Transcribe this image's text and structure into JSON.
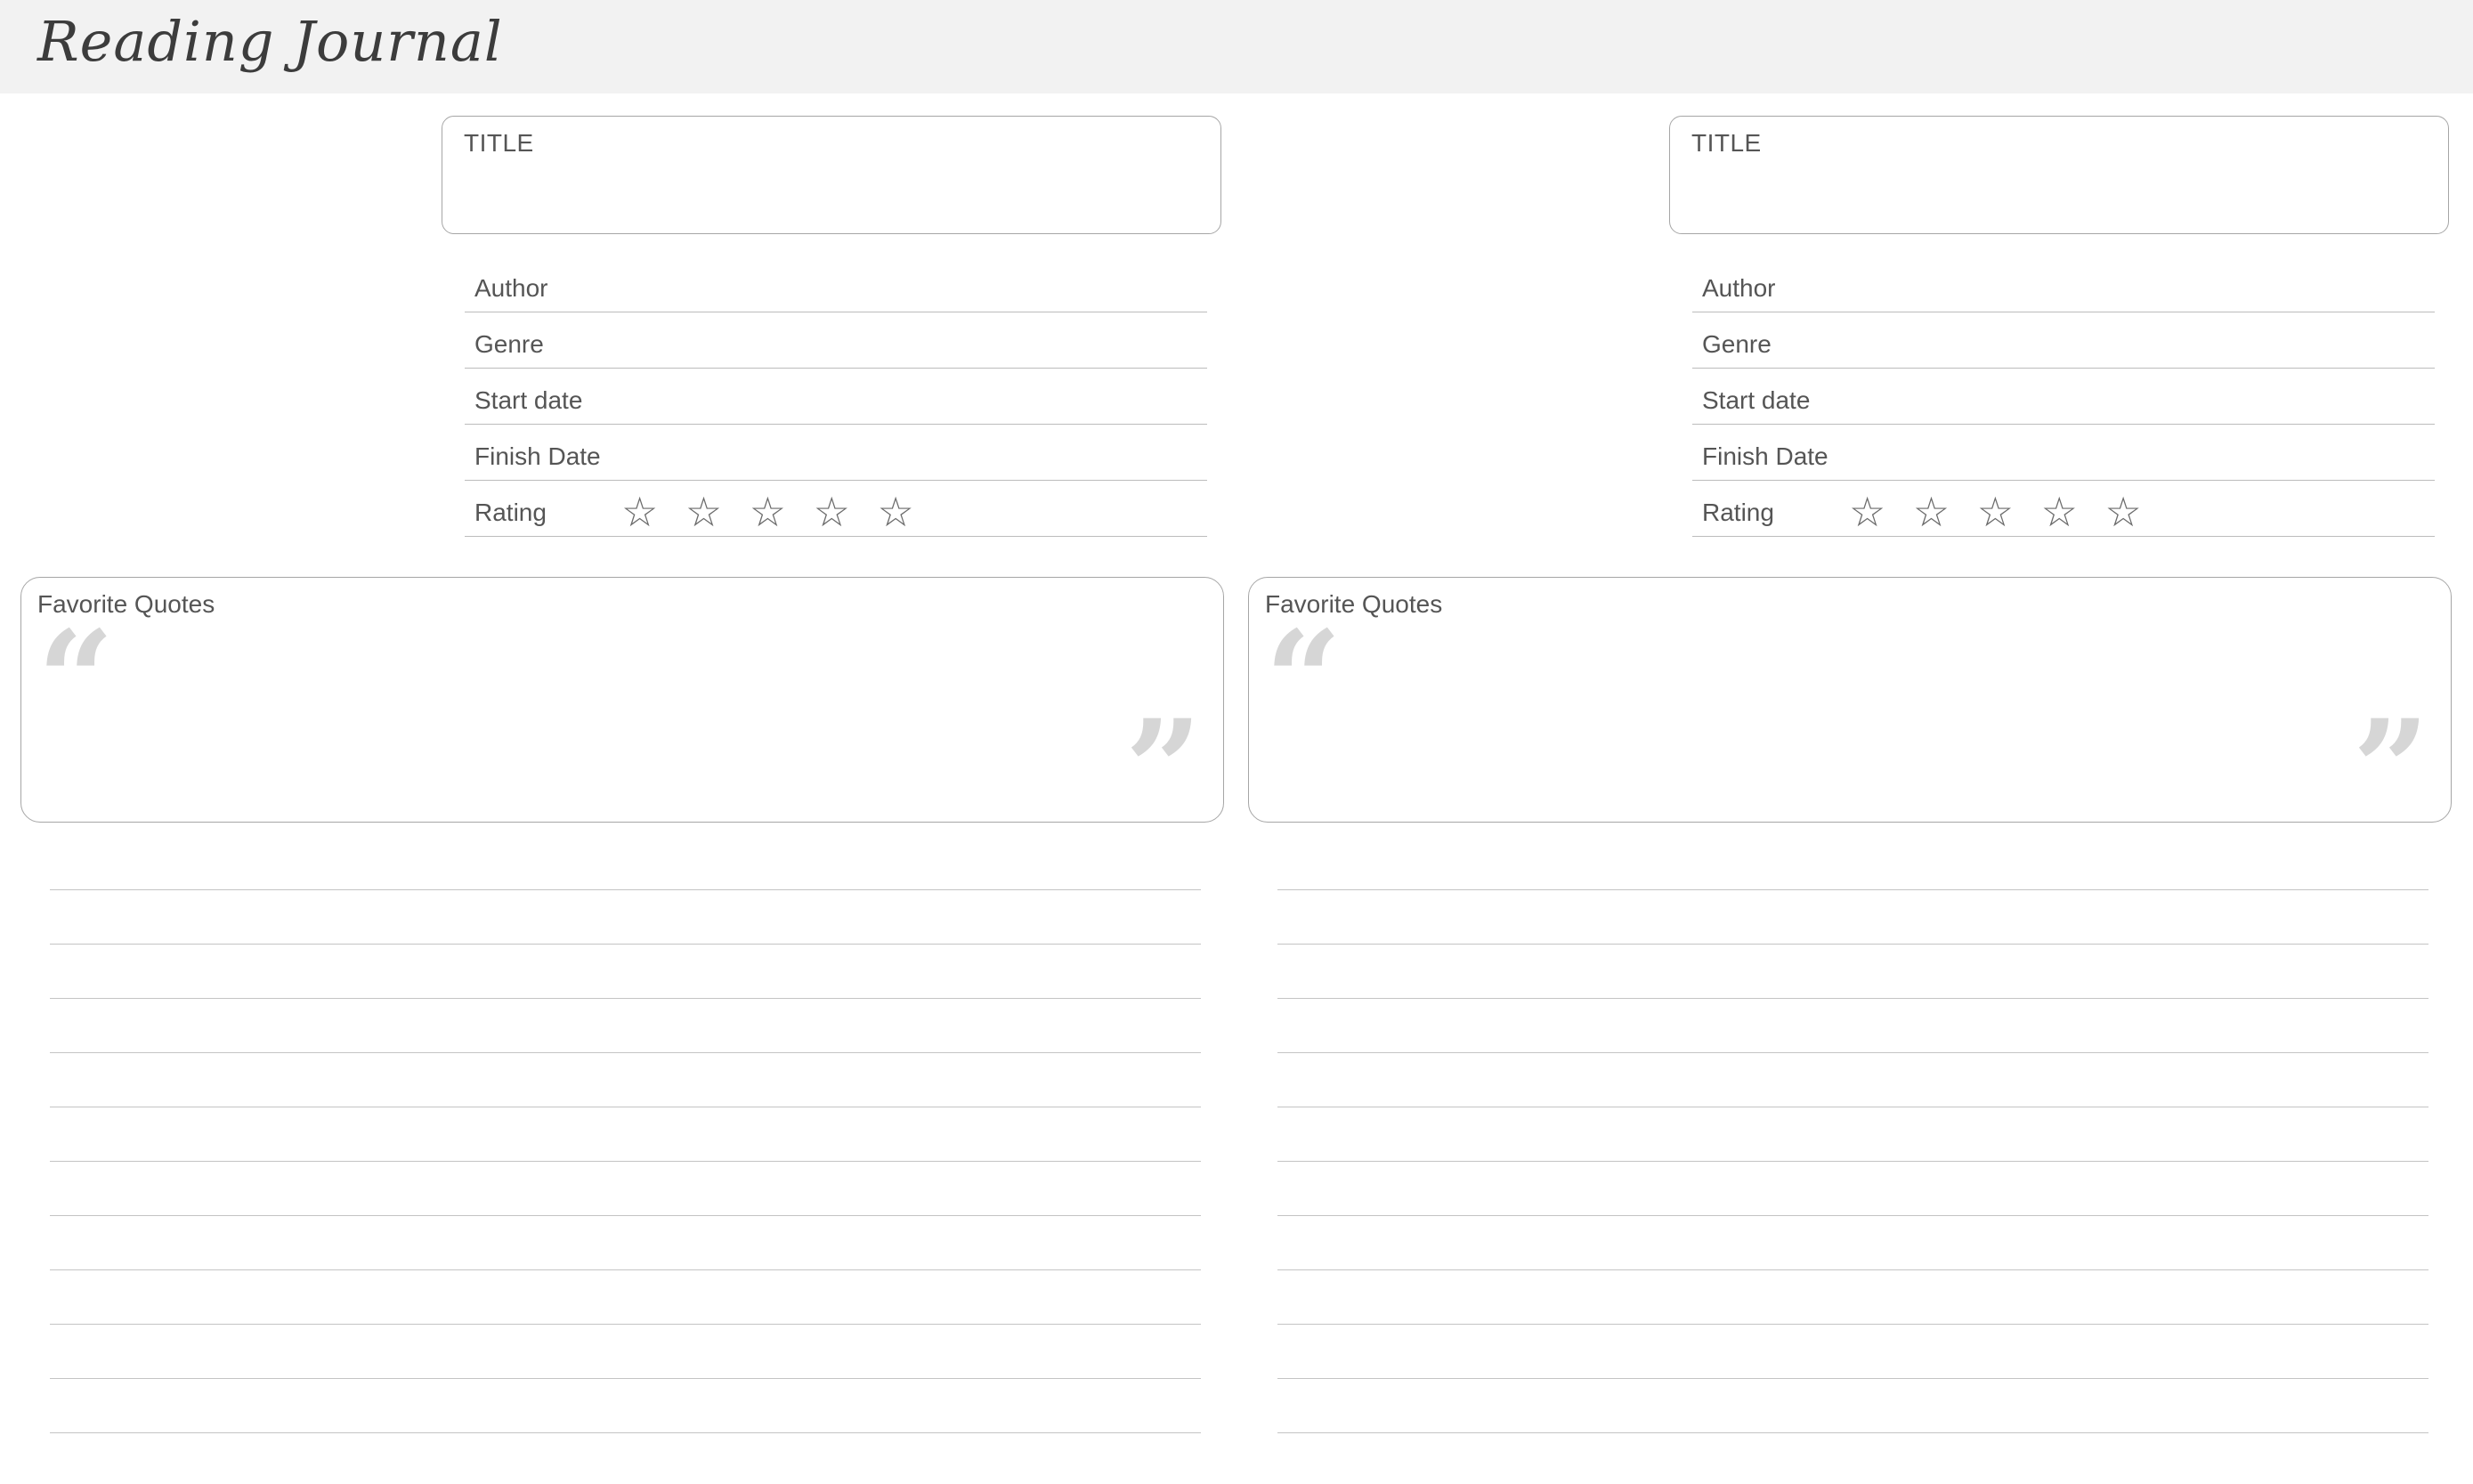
{
  "header": {
    "title": "Reading Journal"
  },
  "pages": [
    {
      "title_label": "TITLE",
      "fields": [
        {
          "label": "Author"
        },
        {
          "label": "Genre"
        },
        {
          "label": "Start date"
        },
        {
          "label": "Finish Date"
        },
        {
          "label": "Rating"
        }
      ],
      "rating": {
        "stars_total": 5,
        "stars_filled": 0,
        "star_glyph": "☆"
      },
      "quotes": {
        "label": "Favorite Quotes",
        "open_mark": "“",
        "close_mark": "”"
      },
      "notes_line_count": 11
    },
    {
      "title_label": "TITLE",
      "fields": [
        {
          "label": "Author"
        },
        {
          "label": "Genre"
        },
        {
          "label": "Start date"
        },
        {
          "label": "Finish Date"
        },
        {
          "label": "Rating"
        }
      ],
      "rating": {
        "stars_total": 5,
        "stars_filled": 0,
        "star_glyph": "☆"
      },
      "quotes": {
        "label": "Favorite Quotes",
        "open_mark": "“",
        "close_mark": "”"
      },
      "notes_line_count": 11
    }
  ],
  "colors": {
    "header_bg": "#f2f2f2",
    "text": "#555555",
    "rule": "#c4c4c4",
    "quote_mark": "#d6d6d6"
  }
}
